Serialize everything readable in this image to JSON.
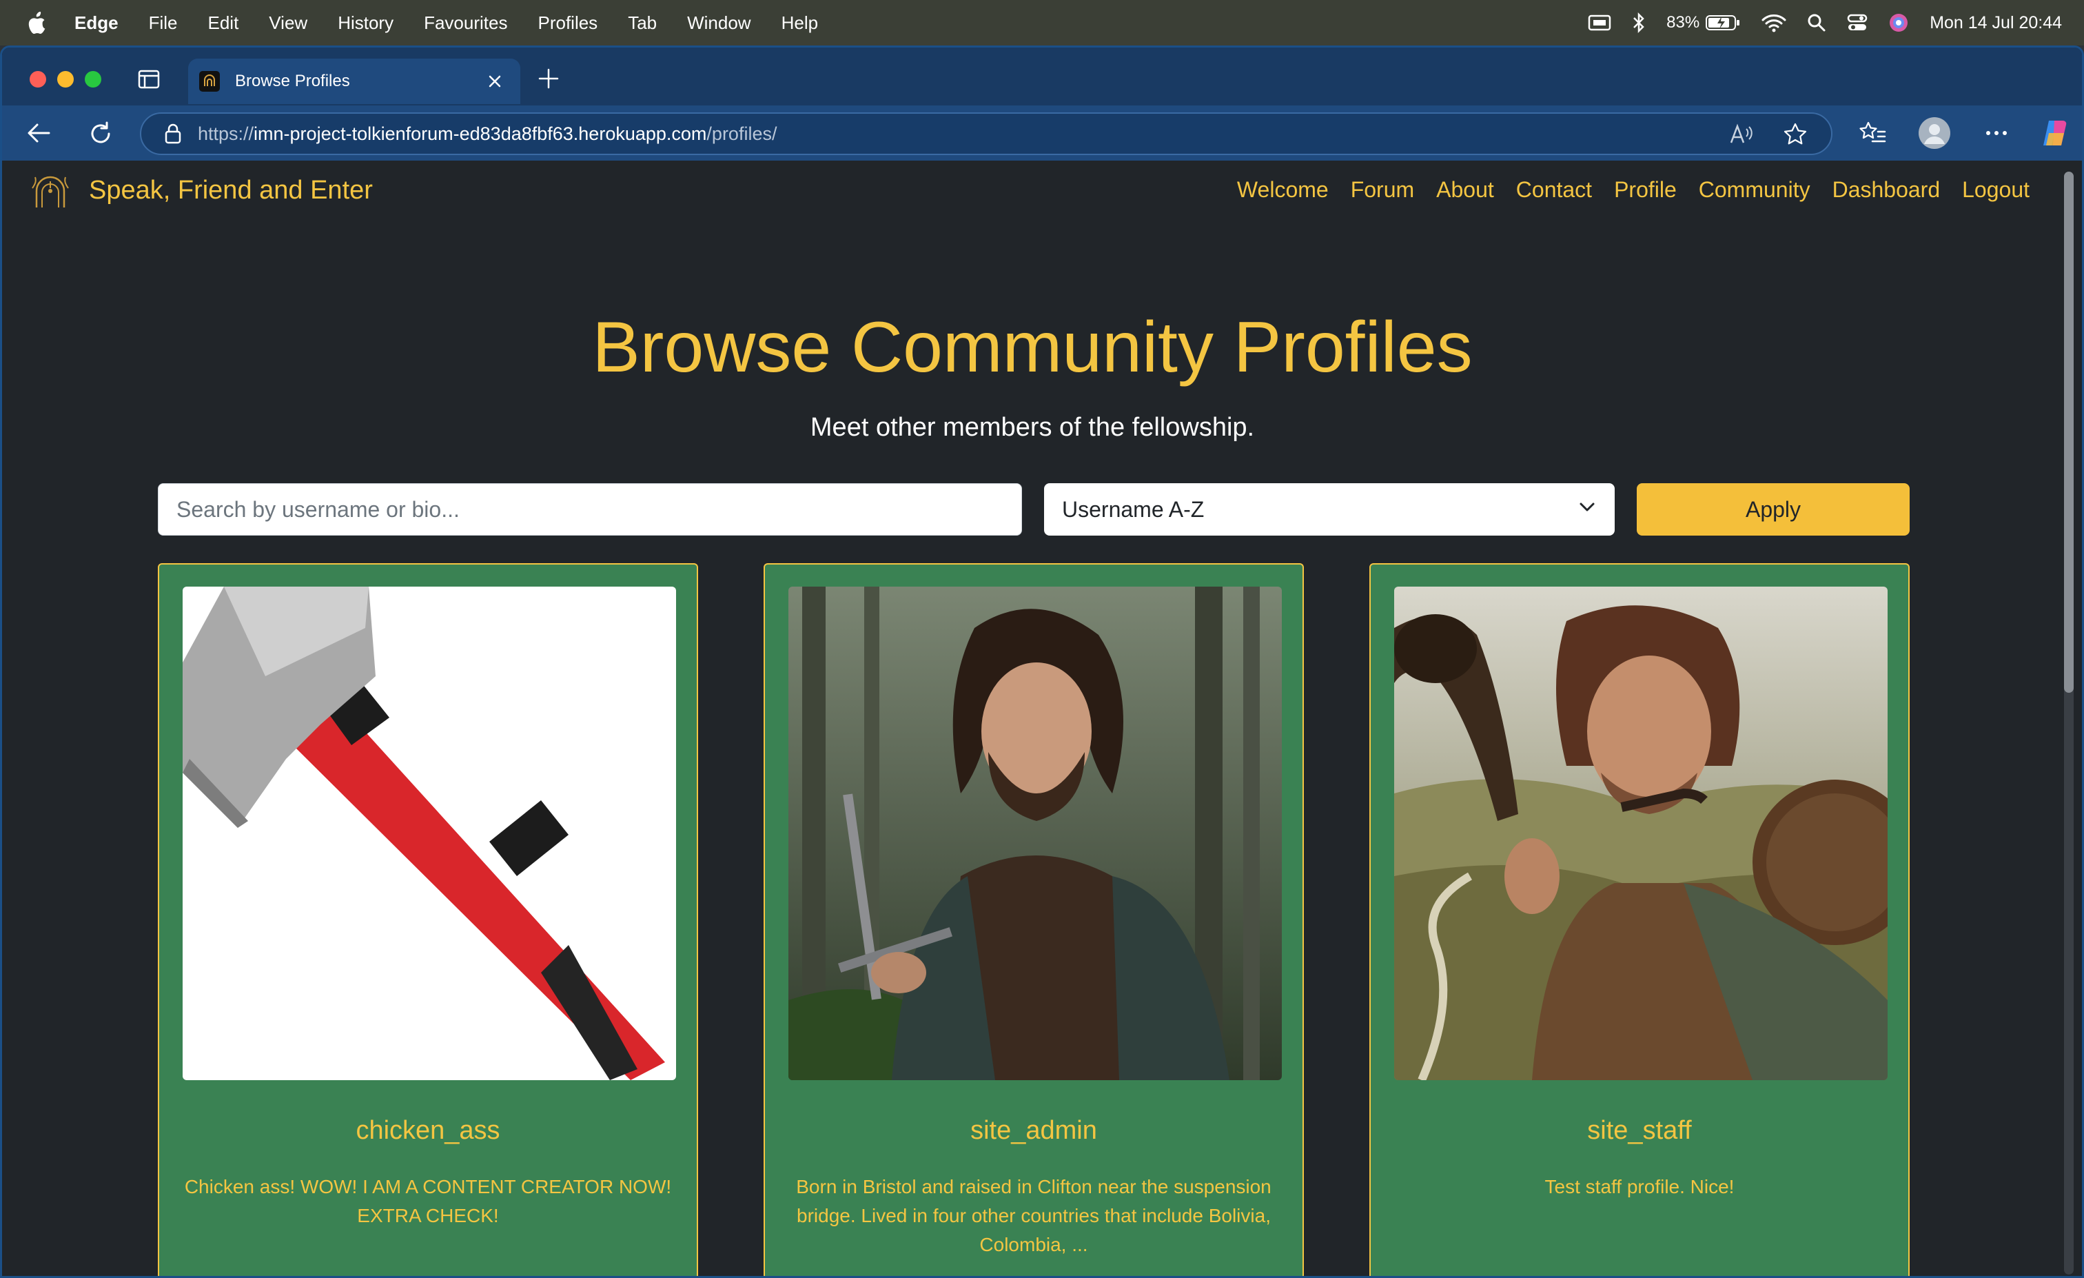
{
  "menubar": {
    "app": "Edge",
    "items": [
      "File",
      "Edit",
      "View",
      "History",
      "Favourites",
      "Profiles",
      "Tab",
      "Window",
      "Help"
    ],
    "battery": "83%",
    "clock": "Mon 14 Jul  20:44"
  },
  "browser": {
    "tab_title": "Browse Profiles",
    "url": {
      "scheme": "https://",
      "host": "imn-project-tolkienforum-ed83da8fbf63.herokuapp.com",
      "path": "/profiles/"
    }
  },
  "site": {
    "brand": "Speak, Friend and Enter",
    "nav": [
      "Welcome",
      "Forum",
      "About",
      "Contact",
      "Profile",
      "Community",
      "Dashboard",
      "Logout"
    ]
  },
  "main": {
    "title": "Browse Community Profiles",
    "subtitle": "Meet other members of the fellowship.",
    "search": {
      "placeholder": "Search by username or bio..."
    },
    "sort": {
      "selected": "Username A-Z"
    },
    "apply_label": "Apply"
  },
  "profiles": [
    {
      "username": "chicken_ass",
      "bio": "Chicken ass! WOW! I AM A CONTENT CREATOR NOW! EXTRA CHECK!",
      "image": "axe-image"
    },
    {
      "username": "site_admin",
      "bio": "Born in Bristol and raised in Clifton near the suspension bridge. Lived in four other countries that include Bolivia, Colombia, ...",
      "image": "ranger-portrait"
    },
    {
      "username": "site_staff",
      "bio": "Test staff profile. Nice!",
      "image": "horn-bearer-portrait"
    }
  ],
  "colors": {
    "accent": "#f4c542",
    "page_bg": "#212529",
    "card_bg": "#3a8253",
    "button_bg": "#f4bf3a",
    "browser_frame": "#1f4a7e"
  }
}
